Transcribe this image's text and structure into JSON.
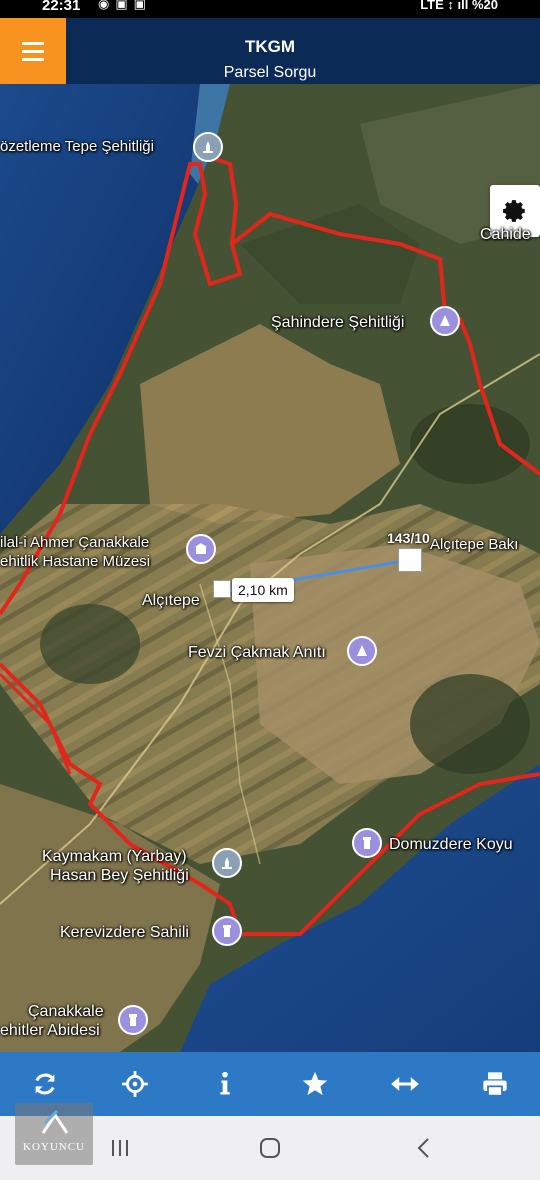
{
  "status_bar": {
    "time": "22:31",
    "network": "LTE",
    "battery": "%20"
  },
  "header": {
    "title": "TKGM",
    "subtitle": "Parsel Sorgu",
    "menu_icon": "hamburger-menu-icon",
    "menu_color": "#f7931e",
    "background": "#0b2a55"
  },
  "map": {
    "settings_icon": "gear-icon",
    "boundary_color": "#e3261b",
    "measure_line_color": "#4a90e2",
    "distance": "2,10 km",
    "parcel_number": "143/10",
    "pois": [
      {
        "label": "özetleme Tepe Şehitliği",
        "icon": "monument-icon"
      },
      {
        "label": "Cahide",
        "icon": ""
      },
      {
        "label": "Şahindere Şehitliği",
        "icon": "pin-icon"
      },
      {
        "label": "ilal-i Ahmer Çanakkale",
        "icon": "museum-icon"
      },
      {
        "label": "ehitlik Hastane Müzesi",
        "icon": ""
      },
      {
        "label": "Alçıtepe Bakı",
        "icon": ""
      },
      {
        "label": "Alçıtepe",
        "icon": ""
      },
      {
        "label": "Fevzi Çakmak Anıtı",
        "icon": "pin-icon"
      },
      {
        "label": "Domuzdere Koyu",
        "icon": "tower-icon"
      },
      {
        "label": "Kaymakam (Yarbay)",
        "icon": "monument-icon"
      },
      {
        "label": "Hasan Bey Şehitliği",
        "icon": ""
      },
      {
        "label": "Kerevizdere Sahili",
        "icon": "tower-icon"
      },
      {
        "label": "Çanakkale",
        "icon": "tower-icon"
      },
      {
        "label": "ehitler Abidesi",
        "icon": ""
      }
    ]
  },
  "toolbar": {
    "background": "#2e79c5",
    "buttons": [
      {
        "icon": "refresh-icon"
      },
      {
        "icon": "crosshair-icon"
      },
      {
        "icon": "info-icon"
      },
      {
        "icon": "star-icon"
      },
      {
        "icon": "measure-arrows-icon"
      },
      {
        "icon": "print-icon"
      }
    ]
  },
  "watermark": {
    "text": "KOYUNCU"
  }
}
